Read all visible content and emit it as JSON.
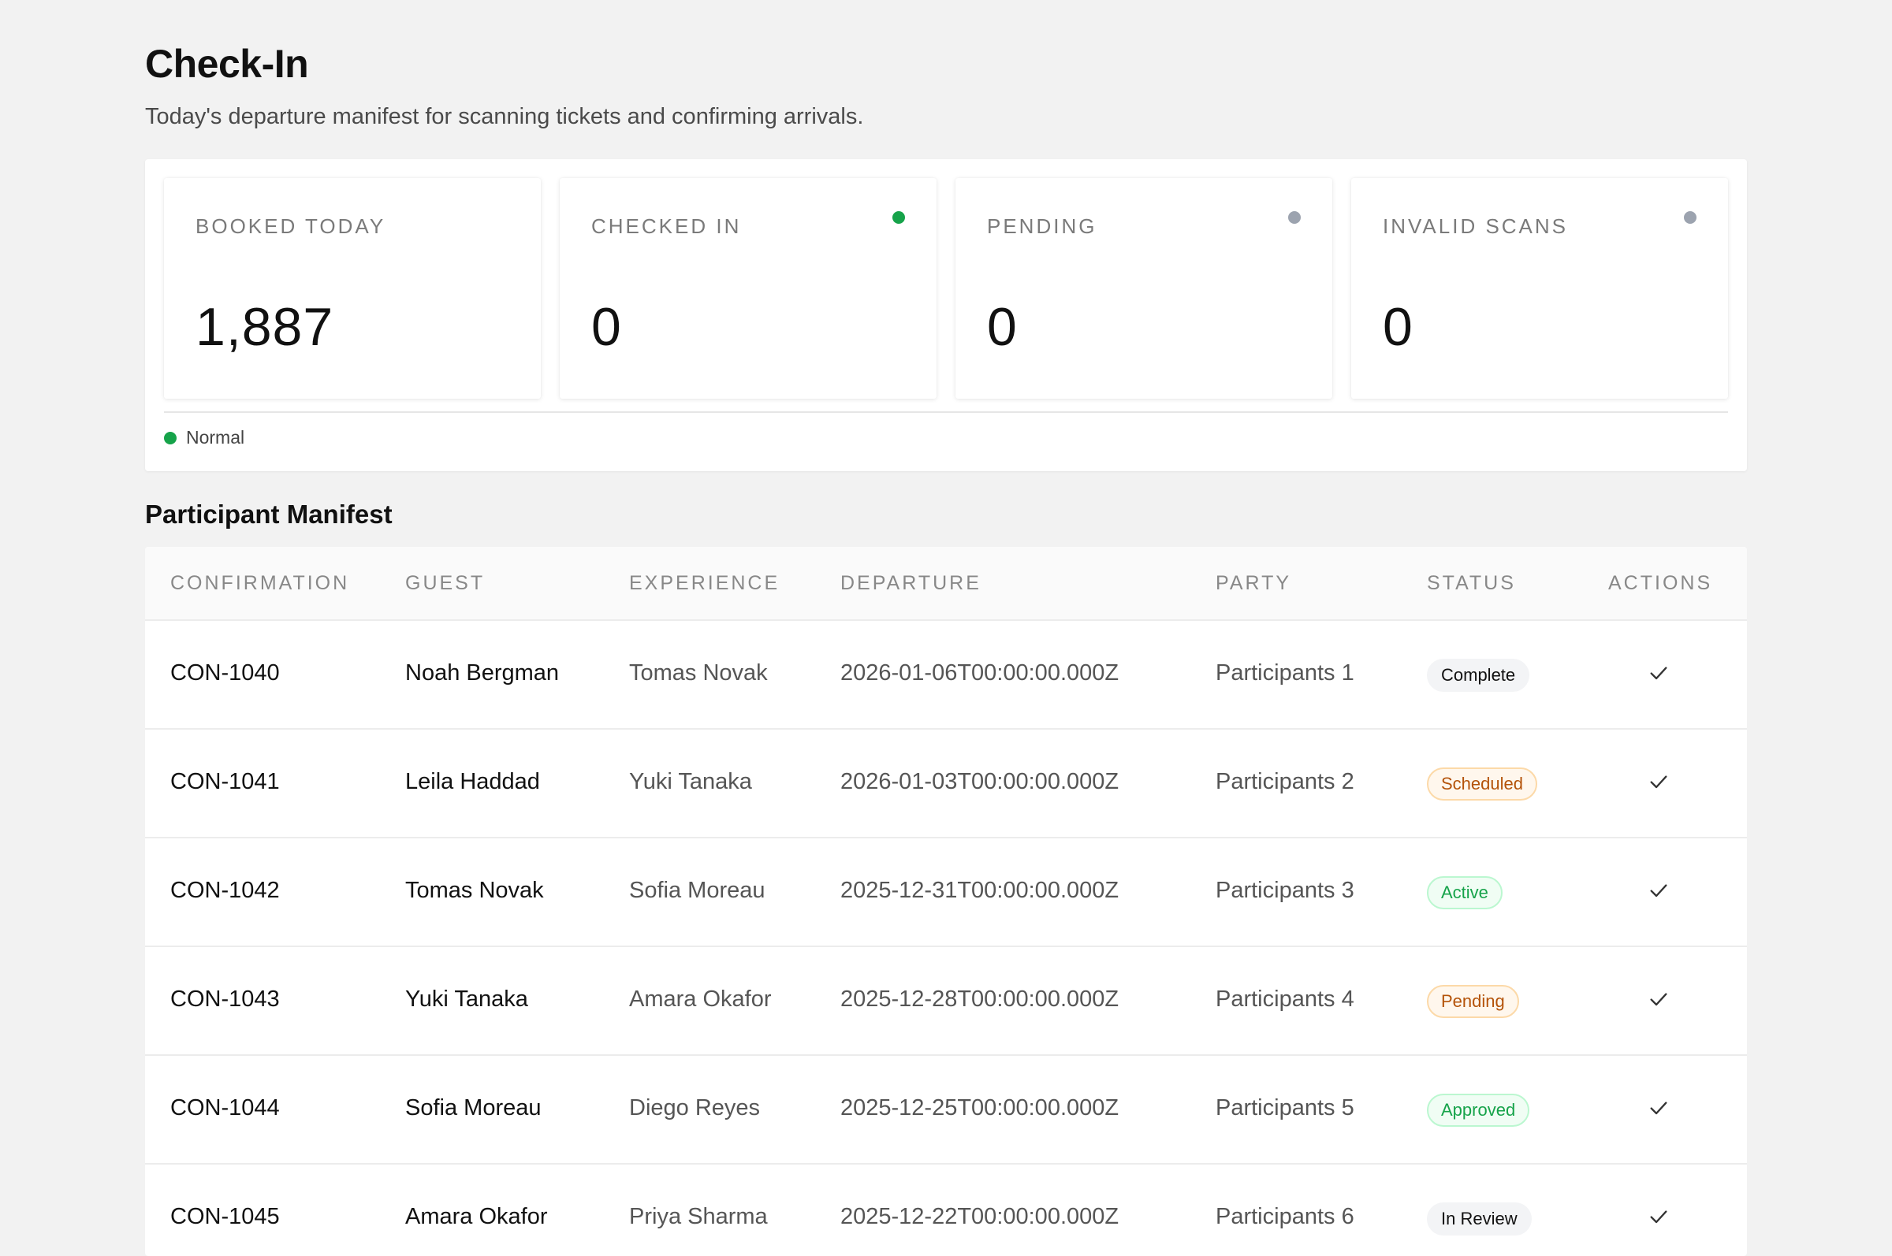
{
  "header": {
    "title": "Check-In",
    "subtitle": "Today's departure manifest for scanning tickets and confirming arrivals."
  },
  "stats": [
    {
      "label": "BOOKED TODAY",
      "value": "1,887",
      "dot_color": ""
    },
    {
      "label": "CHECKED IN",
      "value": "0",
      "dot_color": "#16a34a"
    },
    {
      "label": "PENDING",
      "value": "0",
      "dot_color": "#9ca3af"
    },
    {
      "label": "INVALID SCANS",
      "value": "0",
      "dot_color": "#9ca3af"
    }
  ],
  "health": {
    "label": "Normal",
    "color": "#16a34a"
  },
  "manifest": {
    "title": "Participant Manifest",
    "columns": [
      "CONFIRMATION",
      "GUEST",
      "EXPERIENCE",
      "DEPARTURE",
      "PARTY",
      "STATUS",
      "ACTIONS"
    ],
    "rows": [
      {
        "confirmation": "CON-1040",
        "guest": "Noah Bergman",
        "experience": "Tomas Novak",
        "departure": "2026-01-06T00:00:00.000Z",
        "party": "Participants 1",
        "status": "Complete"
      },
      {
        "confirmation": "CON-1041",
        "guest": "Leila Haddad",
        "experience": "Yuki Tanaka",
        "departure": "2026-01-03T00:00:00.000Z",
        "party": "Participants 2",
        "status": "Scheduled"
      },
      {
        "confirmation": "CON-1042",
        "guest": "Tomas Novak",
        "experience": "Sofia Moreau",
        "departure": "2025-12-31T00:00:00.000Z",
        "party": "Participants 3",
        "status": "Active"
      },
      {
        "confirmation": "CON-1043",
        "guest": "Yuki Tanaka",
        "experience": "Amara Okafor",
        "departure": "2025-12-28T00:00:00.000Z",
        "party": "Participants 4",
        "status": "Pending"
      },
      {
        "confirmation": "CON-1044",
        "guest": "Sofia Moreau",
        "experience": "Diego Reyes",
        "departure": "2025-12-25T00:00:00.000Z",
        "party": "Participants 5",
        "status": "Approved"
      },
      {
        "confirmation": "CON-1045",
        "guest": "Amara Okafor",
        "experience": "Priya Sharma",
        "departure": "2025-12-22T00:00:00.000Z",
        "party": "Participants 6",
        "status": "In Review"
      }
    ]
  },
  "status_styles": {
    "Complete": {
      "bg": "#f3f4f6",
      "fg": "#111111",
      "border": "#f3f4f6"
    },
    "Scheduled": {
      "bg": "#fff7ed",
      "fg": "#b45309",
      "border": "#fcd9a8"
    },
    "Active": {
      "bg": "#f0fdf4",
      "fg": "#16a34a",
      "border": "#bbf7d0"
    },
    "Pending": {
      "bg": "#fff7ed",
      "fg": "#b45309",
      "border": "#fcd9a8"
    },
    "Approved": {
      "bg": "#f0fdf4",
      "fg": "#16a34a",
      "border": "#bbf7d0"
    },
    "In Review": {
      "bg": "#f3f4f6",
      "fg": "#111111",
      "border": "#f3f4f6"
    }
  }
}
